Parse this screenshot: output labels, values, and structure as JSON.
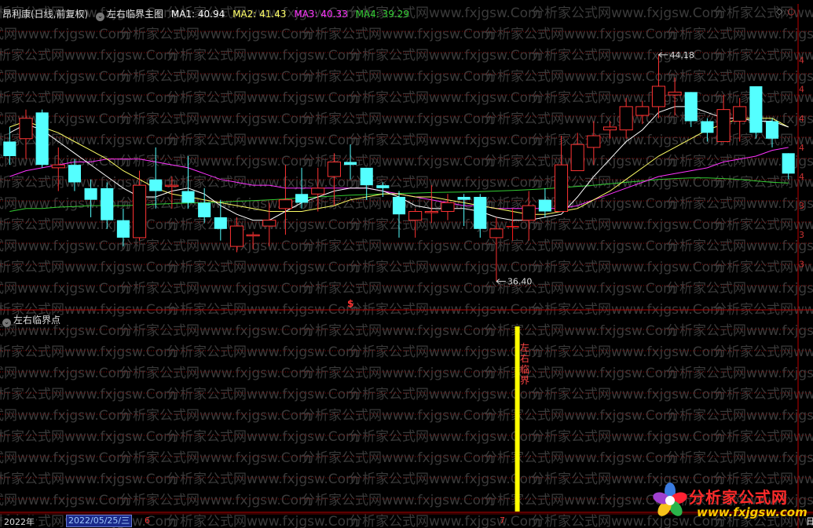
{
  "header": {
    "stock_name": "昂利康(日线,前复权)",
    "indicator_name": "左右临界主图",
    "ma1_label": "MA1: 40.94",
    "ma2_label": "MA2: 41.43",
    "ma3_label": "MA3: 40.33",
    "ma4_label": "MA4: 39.29"
  },
  "sub_panel": {
    "title": "左右临界点",
    "signal_text": "左右临界"
  },
  "annotations": {
    "high": "44.18",
    "low": "36.40",
    "dollar": "$"
  },
  "footer": {
    "year": "2022年",
    "date": "2022/05/25/三",
    "month_6": "6",
    "month_7": "7",
    "right_label": "日"
  },
  "watermark": {
    "text": "分析家公式网www.fxjgsw.Com",
    "brand": "分析家公式网",
    "url": "www.fxjgsw.com"
  },
  "colors": {
    "up": "#ff3333",
    "down": "#54ffff",
    "limit_up": "#ff1a1a",
    "ma1": "#ffffff",
    "ma2": "#ffff66",
    "ma3": "#ff33ff",
    "ma4": "#33cc33",
    "signal": "#ffff00",
    "grid": "#8b0000"
  },
  "chart_data": {
    "type": "candlestick",
    "ylim": [
      35.5,
      45.2
    ],
    "candles": [
      {
        "o": 41.2,
        "h": 41.7,
        "l": 40.4,
        "c": 40.7
      },
      {
        "o": 41.3,
        "h": 42.3,
        "l": 40.6,
        "c": 42.0
      },
      {
        "o": 42.2,
        "h": 42.3,
        "l": 40.3,
        "c": 40.4
      },
      {
        "o": 40.3,
        "h": 41.0,
        "l": 39.5,
        "c": 40.4
      },
      {
        "o": 40.4,
        "h": 40.6,
        "l": 39.5,
        "c": 39.8
      },
      {
        "o": 39.6,
        "h": 39.9,
        "l": 38.6,
        "c": 39.2
      },
      {
        "o": 39.6,
        "h": 39.8,
        "l": 38.2,
        "c": 38.5
      },
      {
        "o": 38.5,
        "h": 38.9,
        "l": 37.6,
        "c": 37.9
      },
      {
        "o": 37.9,
        "h": 40.2,
        "l": 37.8,
        "c": 39.7
      },
      {
        "o": 39.9,
        "h": 41.0,
        "l": 38.9,
        "c": 39.5
      },
      {
        "o": 39.7,
        "h": 40.0,
        "l": 38.9,
        "c": 39.7
      },
      {
        "o": 39.5,
        "h": 40.7,
        "l": 38.9,
        "c": 39.1
      },
      {
        "o": 39.1,
        "h": 39.6,
        "l": 38.4,
        "c": 38.6
      },
      {
        "o": 38.6,
        "h": 39.2,
        "l": 37.8,
        "c": 38.2
      },
      {
        "o": 37.6,
        "h": 38.6,
        "l": 37.4,
        "c": 38.3
      },
      {
        "o": 38.0,
        "h": 38.1,
        "l": 37.5,
        "c": 38.0
      },
      {
        "o": 38.3,
        "h": 39.1,
        "l": 37.6,
        "c": 38.5
      },
      {
        "o": 38.9,
        "h": 40.4,
        "l": 38.0,
        "c": 39.2
      },
      {
        "o": 39.4,
        "h": 40.3,
        "l": 38.9,
        "c": 39.1
      },
      {
        "o": 39.4,
        "h": 40.3,
        "l": 38.8,
        "c": 39.6
      },
      {
        "o": 40.0,
        "h": 40.8,
        "l": 39.0,
        "c": 40.5
      },
      {
        "o": 40.5,
        "h": 41.1,
        "l": 39.9,
        "c": 40.4
      },
      {
        "o": 40.3,
        "h": 40.3,
        "l": 39.2,
        "c": 39.7
      },
      {
        "o": 39.7,
        "h": 39.8,
        "l": 39.3,
        "c": 39.6
      },
      {
        "o": 39.3,
        "h": 39.5,
        "l": 37.9,
        "c": 38.7
      },
      {
        "o": 38.5,
        "h": 38.9,
        "l": 37.9,
        "c": 38.8
      },
      {
        "o": 38.8,
        "h": 39.7,
        "l": 38.4,
        "c": 38.8
      },
      {
        "o": 38.8,
        "h": 39.4,
        "l": 38.5,
        "c": 39.1
      },
      {
        "o": 39.3,
        "h": 39.4,
        "l": 38.3,
        "c": 39.2
      },
      {
        "o": 39.3,
        "h": 39.4,
        "l": 37.9,
        "c": 38.2
      },
      {
        "o": 37.9,
        "h": 38.6,
        "l": 36.4,
        "c": 38.2
      },
      {
        "o": 38.3,
        "h": 38.9,
        "l": 37.8,
        "c": 38.3
      },
      {
        "o": 38.5,
        "h": 39.5,
        "l": 37.8,
        "c": 39.0
      },
      {
        "o": 39.2,
        "h": 39.6,
        "l": 38.6,
        "c": 38.8
      },
      {
        "o": 38.8,
        "h": 41.4,
        "l": 38.8,
        "c": 40.4
      },
      {
        "o": 40.2,
        "h": 41.5,
        "l": 40.2,
        "c": 41.1
      },
      {
        "o": 41.0,
        "h": 41.9,
        "l": 40.4,
        "c": 41.4
      },
      {
        "o": 41.6,
        "h": 41.9,
        "l": 41.3,
        "c": 41.7
      },
      {
        "o": 41.6,
        "h": 42.7,
        "l": 41.3,
        "c": 42.4
      },
      {
        "o": 42.1,
        "h": 42.6,
        "l": 41.8,
        "c": 42.4
      },
      {
        "o": 42.4,
        "h": 44.2,
        "l": 42.0,
        "c": 43.1
      },
      {
        "o": 42.8,
        "h": 43.4,
        "l": 42.1,
        "c": 42.9
      },
      {
        "o": 42.9,
        "h": 42.9,
        "l": 41.7,
        "c": 41.9
      },
      {
        "o": 41.9,
        "h": 42.0,
        "l": 41.2,
        "c": 41.5
      },
      {
        "o": 41.2,
        "h": 42.8,
        "l": 41.3,
        "c": 42.3
      },
      {
        "o": 41.9,
        "h": 42.7,
        "l": 41.2,
        "c": 42.4
      },
      {
        "o": 43.1,
        "h": 43.1,
        "l": 41.3,
        "c": 41.5
      },
      {
        "o": 41.9,
        "h": 42.0,
        "l": 41.0,
        "c": 41.3
      },
      {
        "o": 40.8,
        "h": 40.8,
        "l": 39.9,
        "c": 40.1
      }
    ],
    "ma1": [
      41.5,
      41.8,
      41.6,
      41.2,
      40.8,
      40.4,
      40.0,
      39.6,
      39.3,
      39.3,
      39.5,
      39.6,
      39.4,
      39.0,
      38.7,
      38.5,
      38.5,
      38.8,
      39.1,
      39.3,
      39.5,
      39.6,
      39.6,
      39.5,
      39.3,
      39.0,
      38.9,
      38.9,
      38.9,
      38.8,
      38.6,
      38.5,
      38.5,
      38.6,
      38.7,
      39.3,
      40.0,
      40.6,
      41.2,
      41.6,
      42.2,
      42.4,
      42.4,
      42.2,
      42.0,
      42.0,
      41.9,
      41.9,
      41.7
    ],
    "ma2": [
      41.7,
      41.9,
      41.7,
      41.5,
      41.2,
      40.9,
      40.6,
      40.2,
      39.9,
      39.6,
      39.4,
      39.3,
      39.2,
      39.1,
      39.0,
      38.9,
      38.8,
      38.8,
      38.8,
      38.9,
      39.0,
      39.2,
      39.3,
      39.4,
      39.4,
      39.3,
      39.3,
      39.2,
      39.1,
      39.0,
      38.9,
      38.8,
      38.7,
      38.7,
      38.8,
      38.9,
      39.2,
      39.5,
      39.9,
      40.3,
      40.7,
      41.0,
      41.3,
      41.6,
      41.8,
      42.0,
      42.0,
      42.0,
      41.7
    ],
    "ma3": [
      40.0,
      40.2,
      40.3,
      40.4,
      40.5,
      40.5,
      40.6,
      40.6,
      40.6,
      40.5,
      40.4,
      40.3,
      40.1,
      39.9,
      39.8,
      39.7,
      39.7,
      39.6,
      39.6,
      39.6,
      39.6,
      39.6,
      39.6,
      39.5,
      39.4,
      39.3,
      39.2,
      39.1,
      39.0,
      39.0,
      38.9,
      38.9,
      38.9,
      38.9,
      38.9,
      39.0,
      39.2,
      39.4,
      39.6,
      39.8,
      40.0,
      40.1,
      40.2,
      40.3,
      40.5,
      40.6,
      40.7,
      40.9,
      41.0
    ],
    "ma4": [
      38.8,
      38.9,
      38.9,
      38.95,
      38.97,
      39.0,
      39.0,
      39.0,
      39.02,
      39.05,
      39.07,
      39.09,
      39.1,
      39.12,
      39.15,
      39.17,
      39.2,
      39.23,
      39.27,
      39.3,
      39.33,
      39.36,
      39.38,
      39.4,
      39.42,
      39.43,
      39.45,
      39.46,
      39.47,
      39.48,
      39.5,
      39.52,
      39.55,
      39.58,
      39.62,
      39.66,
      39.7,
      39.75,
      39.8,
      39.85,
      39.9,
      39.93,
      39.95,
      39.95,
      39.93,
      39.9,
      39.85,
      39.8,
      39.78
    ],
    "limit_up_index": 31,
    "signal_index": 31,
    "high_point": {
      "index": 40,
      "value": 44.18
    },
    "low_point": {
      "index": 30,
      "value": 36.4
    },
    "dollar_index": 21
  }
}
